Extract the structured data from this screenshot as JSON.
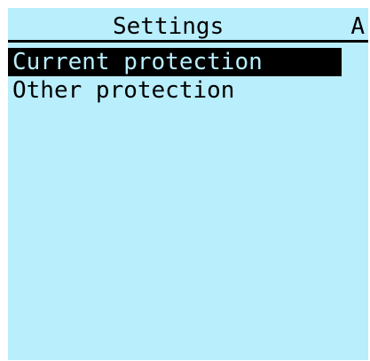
{
  "header": {
    "title": "Settings",
    "indicator": "A"
  },
  "menu": {
    "items": [
      {
        "label": "Current protection",
        "selected": true
      },
      {
        "label": "Other protection",
        "selected": false
      }
    ]
  },
  "colors": {
    "screen_background": "#b9eefc",
    "foreground": "#000000"
  }
}
